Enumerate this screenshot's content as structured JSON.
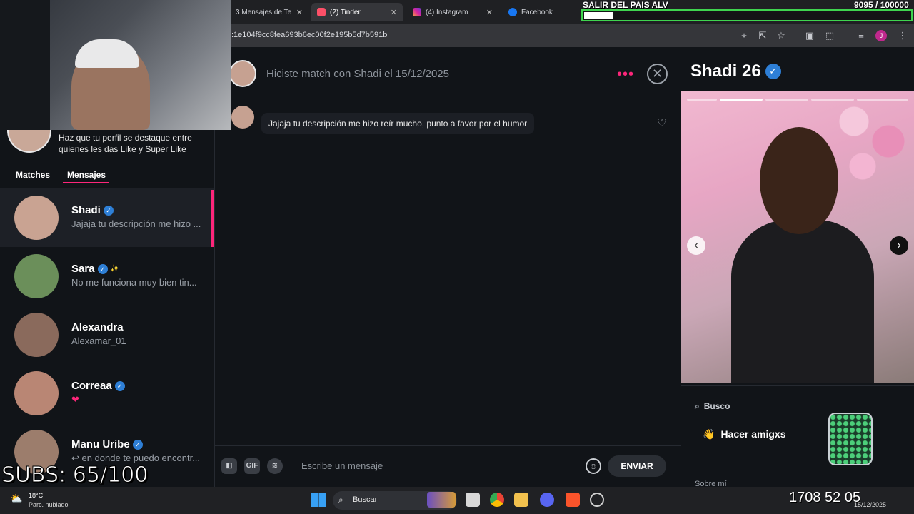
{
  "browser": {
    "tabs": [
      {
        "label": "3 Mensajes de Te"
      },
      {
        "label": "(2) Tinder"
      },
      {
        "label": "(4) Instagram"
      },
      {
        "label": "Facebook"
      }
    ],
    "url": ":1e104f9cc8fea693b6ec00f2e195b5d7b591b"
  },
  "stream": {
    "goal_title": "SALIR DEL PAIS ALV",
    "goal_count": "9095 / 100000",
    "goal_progress": 0.09,
    "subs": "SUBS: 65/100"
  },
  "sidebar": {
    "promo_text": "Haz que tu perfil se destaque entre quienes les das Like y Super Like",
    "tabs": {
      "matches": "Matches",
      "messages": "Mensajes"
    },
    "conversations": [
      {
        "name": "Shadi",
        "preview": "Jajaja tu descripción me hizo ...",
        "verified": true,
        "avatar_color": "#c9a392"
      },
      {
        "name": "Sara",
        "preview": "No me funciona muy bien tin...",
        "verified": true,
        "avatar_color": "#6b8f5a"
      },
      {
        "name": "Alexandra",
        "preview": "Alexamar_01",
        "verified": false,
        "avatar_color": "#8a6a5c"
      },
      {
        "name": "Correaa",
        "preview": "❤",
        "verified": true,
        "avatar_color": "#b98674"
      },
      {
        "name": "Manu Uribe",
        "preview": "↩ en donde te puedo encontr...",
        "verified": true,
        "avatar_color": "#9c7d6c"
      }
    ]
  },
  "chat": {
    "title": "Hiciste match con Shadi el 15/12/2025",
    "message": "Jajaja tu descripción me hizo reír mucho, punto a favor por el humor",
    "compose_placeholder": "Escribe un mensaje",
    "gif_label": "GIF",
    "send_label": "ENVIAR",
    "accent_color": "#fd267a"
  },
  "profile": {
    "name_age": "Shadi 26",
    "busco_label": "Busco",
    "busco_value": "Hacer amigxs",
    "busco_icon": "👋",
    "sobre_label": "Sobre mí"
  },
  "taskbar": {
    "weather_temp": "18°C",
    "weather_desc": "Parc. nublado",
    "search_label": "Buscar",
    "clock": "1708 52 05",
    "date": "15/12/2025"
  }
}
